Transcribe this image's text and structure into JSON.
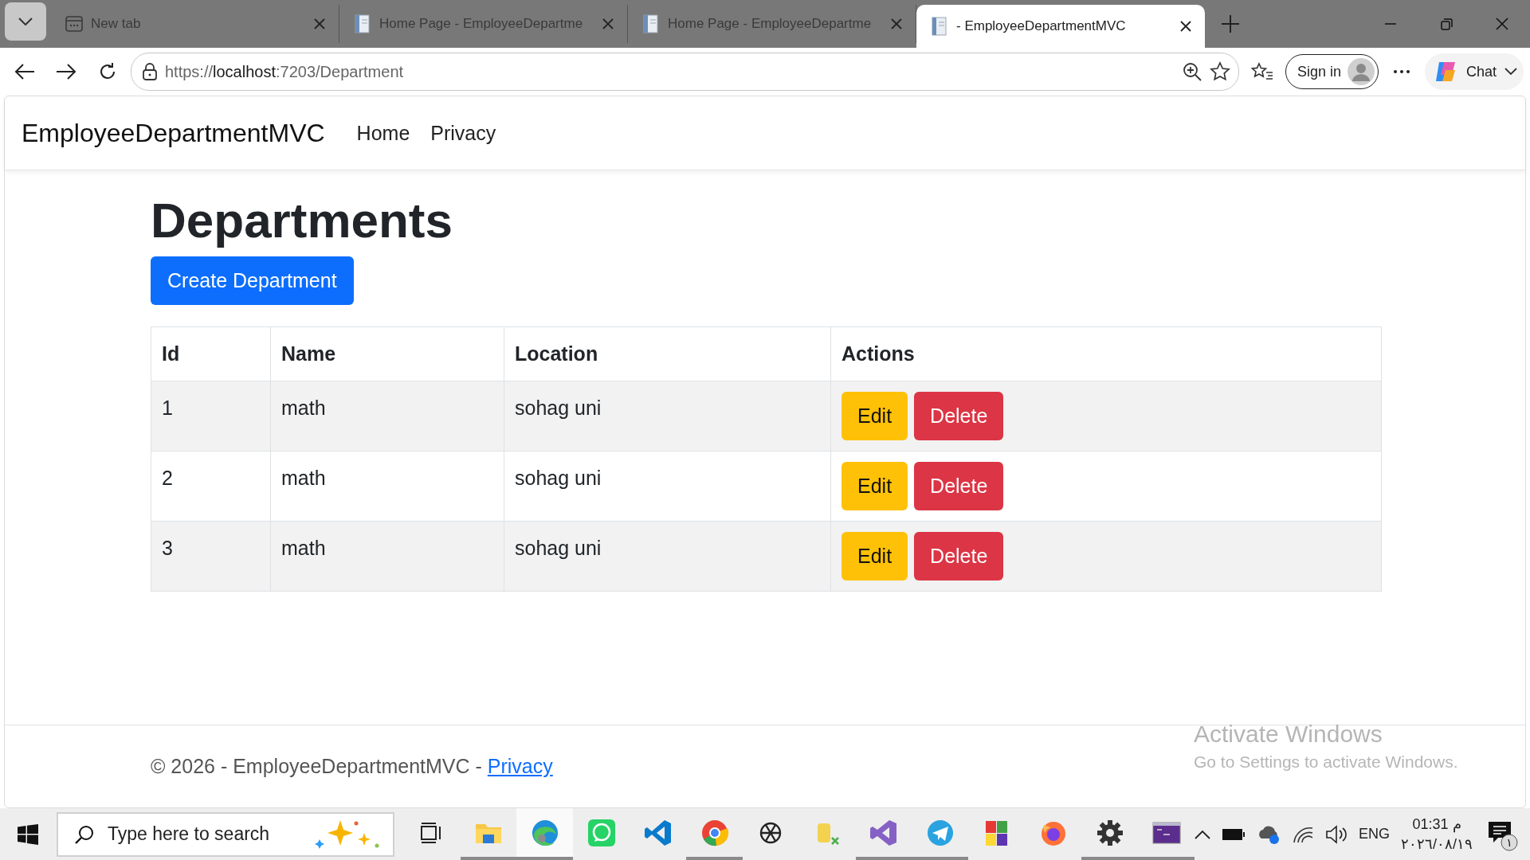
{
  "browser": {
    "tabs": [
      {
        "kind": "newtab",
        "title": "New tab",
        "selected": false
      },
      {
        "kind": "page",
        "title": "Home Page - EmployeeDepartme",
        "selected": false
      },
      {
        "kind": "page",
        "title": "Home Page - EmployeeDepartme",
        "selected": false
      },
      {
        "kind": "page",
        "title": "- EmployeeDepartmentMVC",
        "selected": true
      }
    ],
    "url": {
      "scheme": "https://",
      "host": "localhost",
      "path": ":7203/Department"
    },
    "sign_in": "Sign in",
    "chat": "Chat"
  },
  "navbar": {
    "brand": "EmployeeDepartmentMVC",
    "links": [
      "Home",
      "Privacy"
    ]
  },
  "page": {
    "heading": "Departments",
    "create_button": "Create Department",
    "table": {
      "columns": [
        "Id",
        "Name",
        "Location",
        "Actions"
      ],
      "rows": [
        {
          "id": "1",
          "name": "math",
          "location": "sohag uni",
          "actions": [
            "Edit",
            "Delete"
          ]
        },
        {
          "id": "2",
          "name": "math",
          "location": "sohag uni",
          "actions": [
            "Edit",
            "Delete"
          ]
        },
        {
          "id": "3",
          "name": "math",
          "location": "sohag uni",
          "actions": [
            "Edit",
            "Delete"
          ]
        }
      ]
    }
  },
  "footer": {
    "text": "© 2026 - EmployeeDepartmentMVC - ",
    "link": "Privacy"
  },
  "activation": {
    "title": "Activate Windows",
    "subtitle": "Go to Settings to activate Windows."
  },
  "taskbar": {
    "search_placeholder": "Type here to search",
    "apps": [
      {
        "kind": "explorer",
        "running": true,
        "selected": false
      },
      {
        "kind": "edge",
        "running": true,
        "selected": true
      },
      {
        "kind": "whatsapp",
        "running": false,
        "selected": false
      },
      {
        "kind": "vscode",
        "running": false,
        "selected": false
      },
      {
        "kind": "chrome",
        "running": true,
        "selected": false
      },
      {
        "kind": "openai",
        "running": false,
        "selected": false
      },
      {
        "kind": "database",
        "running": false,
        "selected": false
      },
      {
        "kind": "visualstudio",
        "running": true,
        "selected": false
      },
      {
        "kind": "telegram",
        "running": true,
        "selected": false
      },
      {
        "kind": "blocks",
        "running": false,
        "selected": false
      },
      {
        "kind": "firefox",
        "running": false,
        "selected": false
      },
      {
        "kind": "settings",
        "running": true,
        "selected": false
      },
      {
        "kind": "terminal",
        "running": true,
        "selected": false
      }
    ],
    "language": "ENG",
    "time": "01:31 م",
    "date": "٢٠٢٦/٠٨/١٩",
    "notifications": "١"
  }
}
